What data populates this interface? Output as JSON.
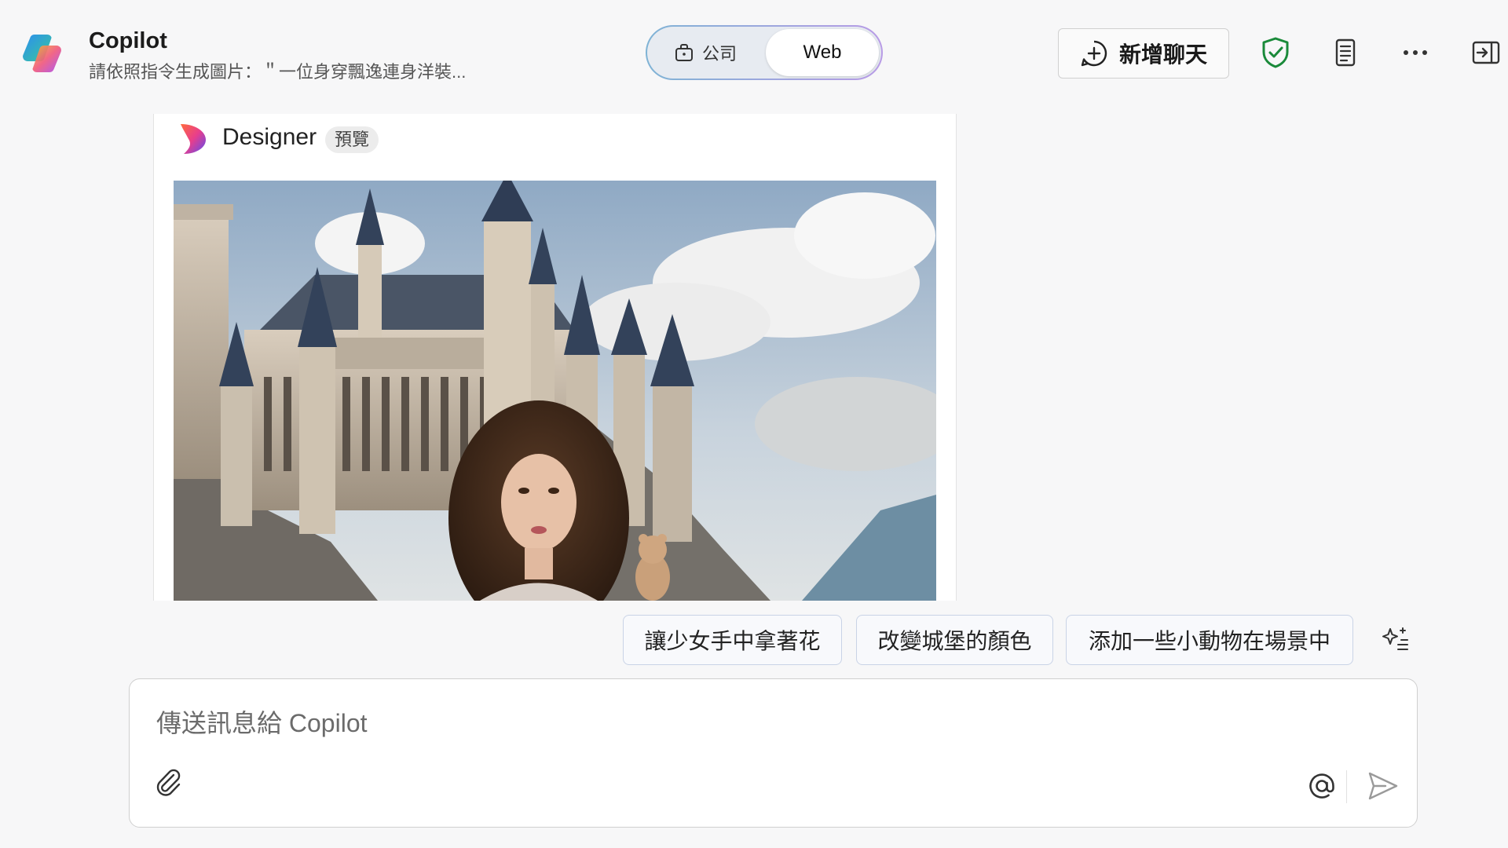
{
  "app": {
    "title": "Copilot",
    "chat_subtitle": "請依照指令生成圖片：＂一位身穿飄逸連身洋裝..."
  },
  "mode_toggle": {
    "work_label": "公司",
    "web_label": "Web",
    "selected": "Web"
  },
  "toolbar": {
    "new_chat_label": "新增聊天",
    "icons": [
      "plus-circle-icon",
      "shield-check-icon",
      "notebook-icon",
      "more-icon",
      "sidebar-toggle-icon"
    ],
    "shield_color": "#1a8a3a"
  },
  "designer_card": {
    "name": "Designer",
    "badge": "預覽"
  },
  "suggestions": [
    "讓少女手中拿著花",
    "改變城堡的顏色",
    "添加一些小動物在場景中"
  ],
  "composer": {
    "placeholder": "傳送訊息給 Copilot",
    "value": ""
  },
  "colors": {
    "background": "#f7f7f8",
    "toggle_gradient_start": "#7fb3d5",
    "toggle_gradient_end": "#b89be6"
  }
}
